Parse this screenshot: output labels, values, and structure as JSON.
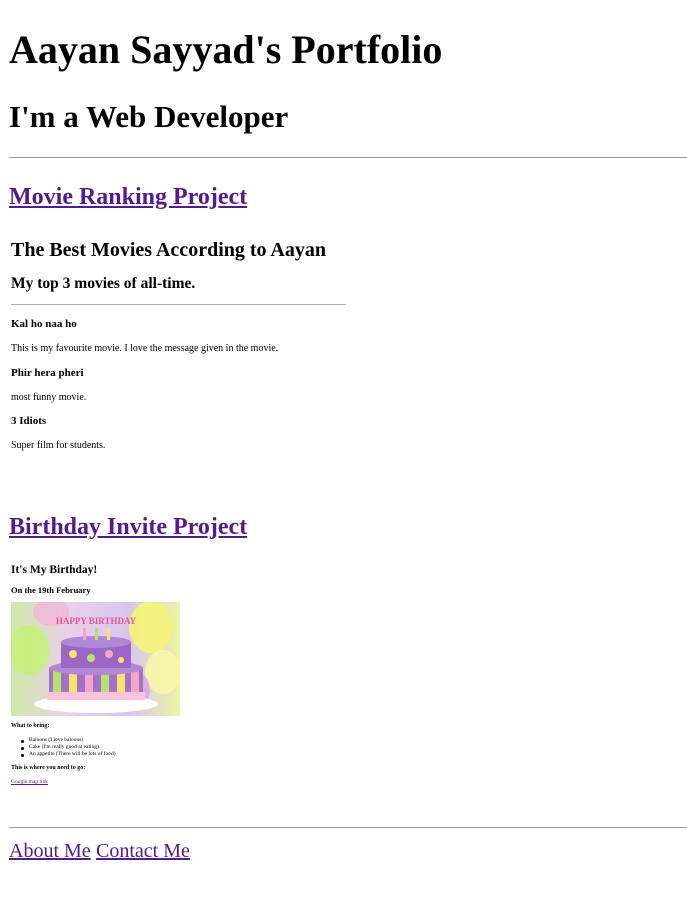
{
  "header": {
    "title": "Aayan Sayyad's Portfolio",
    "subtitle": "I'm a Web Developer"
  },
  "movie_project": {
    "link_label": "Movie Ranking Project",
    "title": "The Best Movies According to Aayan",
    "subtitle": "My top 3 movies of all-time.",
    "movies": [
      {
        "name": "Kal ho naa ho",
        "desc": "This is my favourite movie. I love the message given in the movie."
      },
      {
        "name": "Phir hera pheri",
        "desc": "most funny movie."
      },
      {
        "name": "3 Idiots",
        "desc": "Super film for students."
      }
    ]
  },
  "birthday_project": {
    "link_label": "Birthday Invite Project",
    "title": "It's My Birthday!",
    "date": "On the 19th February",
    "image_alt": "birthday cake",
    "cake_text": "HAPPY BIRTHDAY",
    "bring_heading": "What to bring:",
    "bring_items": [
      "Baloons (I love baloons)",
      "Cake (I'm really good at eating)",
      "An appetite (There will be lots of food)"
    ],
    "location_heading": "This is where you need to go:",
    "map_link": "Google map link"
  },
  "footer": {
    "about_label": "About Me",
    "contact_label": "Contact Me"
  }
}
